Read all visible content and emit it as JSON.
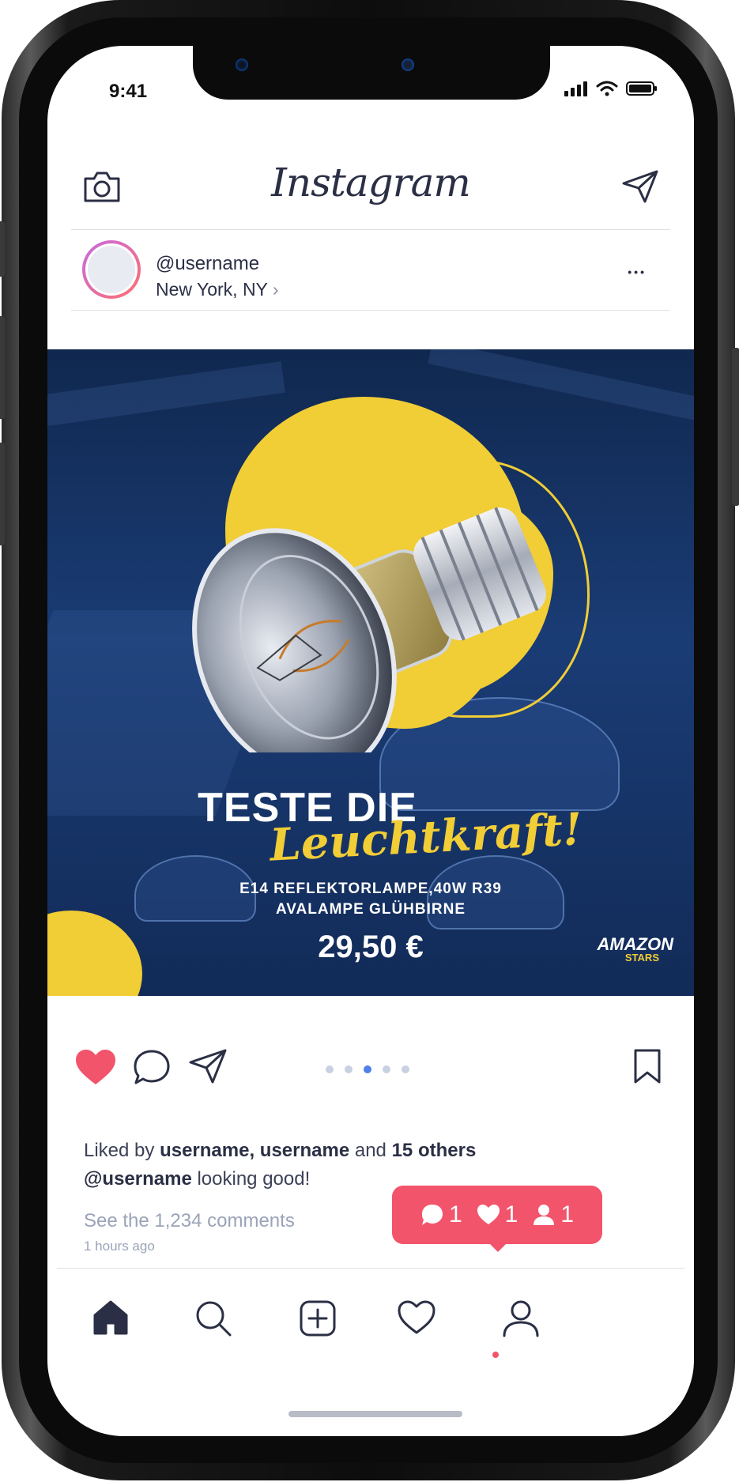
{
  "status_bar": {
    "time": "9:41"
  },
  "header": {
    "logo": "Instagram"
  },
  "post": {
    "username": "@username",
    "location": "New York, NY",
    "location_chevron": "›",
    "more": "•••"
  },
  "ad": {
    "headline_1": "TESTE DIE",
    "headline_2": "Leuchtkraft!",
    "product_line_1": "E14 REFLEKTORLAMPE,40W R39",
    "product_line_2": "AVALAMPE GLÜHBIRNE",
    "price": "29,50 €",
    "brand_1": "AMAZON",
    "brand_2": "STARS",
    "accent_color": "#f1cd36",
    "background_color": "#15315f"
  },
  "actions": {
    "carousel_dots": 5,
    "carousel_active_index": 2,
    "liked": true
  },
  "caption": {
    "liked_by_prefix": "Liked by",
    "liked_by_users": "username, username",
    "liked_by_and": "and",
    "liked_by_others": "15 others",
    "author": "@username",
    "text": "looking good!",
    "comments_link": "See the 1,234 comments",
    "time_ago": "1 hours ago"
  },
  "notification": {
    "comments": "1",
    "likes": "1",
    "followers": "1",
    "color": "#f2546b"
  },
  "tabbar": {
    "items": [
      "home-icon",
      "search-icon",
      "add-post-icon",
      "activity-heart-icon",
      "profile-icon"
    ]
  }
}
